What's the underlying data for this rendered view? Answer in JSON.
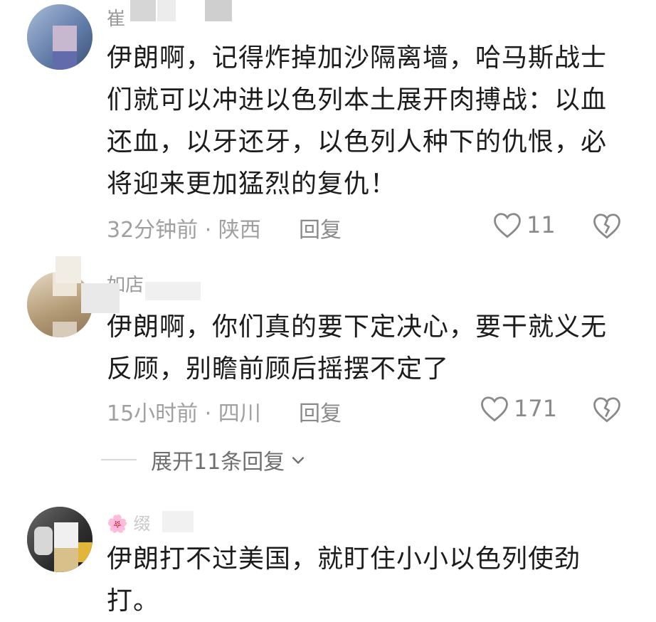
{
  "comments": [
    {
      "username": "崔",
      "text": "伊朗啊，记得炸掉加沙隔离墙，哈马斯战士们就可以冲进以色列本土展开肉搏战：以血还血，以牙还牙，以色列人种下的仇恨，必将迎来更加猛烈的复仇！",
      "time": "32分钟前 · 陕西",
      "reply_label": "回复",
      "likes": "11",
      "avatar_color": "#6e87b4"
    },
    {
      "username": "如店",
      "text": "伊朗啊，你们真的要下定决心，要干就义无反顾，别瞻前顾后摇摆不定了",
      "time": "15小时前 · 四川",
      "reply_label": "回复",
      "likes": "171",
      "avatar_color": "#b39a7a"
    },
    {
      "username": "🌸 缀",
      "text": "伊朗打不过美国，就盯住小小以色列使劲打。",
      "avatar_color": "#4a4a4a"
    }
  ],
  "expand_replies": "展开11条回复",
  "icons": {
    "like": "heart-outline-icon",
    "dislike": "broken-heart-icon",
    "expand": "chevron-down-icon"
  }
}
